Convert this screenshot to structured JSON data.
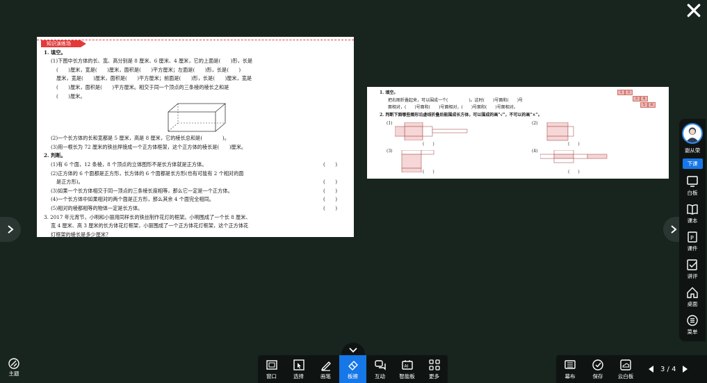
{
  "window": {
    "close_icon": "close-icon"
  },
  "page1": {
    "banner": "知识演练场",
    "q1": {
      "title": "1. 填空。",
      "lines": [
        "(1)下图中长方体的长、宽、高分别是 8 厘米、6 厘米、4 厘米，它的上面是(　　)形，长是",
        "(　　)厘米，宽是(　　)厘米，面积是(　　)平方厘米；左面是(　　)形，长是(　　)",
        "厘米，宽是(　　)厘米，面积是(　　)平方厘米；前面是(　　)形，长是(　　)厘米，宽是",
        "(　　)厘米，面积是(　　)平方厘米。相交于同一个顶点的三条棱的棱长之和是",
        "(　　)厘米。"
      ],
      "line2": "(2)一个长方体的长和宽都是 5 厘米，高是 8 厘米，它的棱长总和是(　　　　)。",
      "line3": "(3)用一根长为 72 厘米的铁丝焊接成一个正方体框架，这个正方体的棱长是(　　)厘米。"
    },
    "q2": {
      "title": "2. 判断。",
      "items": [
        {
          "text": "(1)有 6 个面，12 条棱，8 个顶点的立体图形不是长方体就是正方体。",
          "mark": "(　　)"
        },
        {
          "text": "(2)正方体的 6 个面都是正方形，长方体的 6 个面都是长方形(也有可能有 2 个相对的面",
          "mark": ""
        },
        {
          "text": "是正方形)。",
          "mark": "(　　)"
        },
        {
          "text": "(3)如果一个长方体相交于同一顶点的三条棱长度相等，那么它一定是一个正方体。",
          "mark": "(　　)"
        },
        {
          "text": "(4)一个长方体中如果相对的两个面是正方形，那么其余 4 个面完全相同。",
          "mark": "(　　)"
        },
        {
          "text": "(5)相对的棱都相等的物体一定是长方体。",
          "mark": "(　　)"
        }
      ]
    },
    "q3": {
      "lines": [
        "3. 2017 年元宵节，小明和小丽用同样长的铁丝制作花灯的框架。小明围成了一个长 8 厘米、",
        "宽 4 厘米、高 3 厘米的长方体花灯框架，小丽围成了一个正方体花灯框架，这个正方体花",
        "灯框架的棱长是多少厘米？"
      ]
    }
  },
  "page2": {
    "q1": {
      "title": "1. 填空。",
      "line1": "把右图折叠起来，可以围成一个(　　　　　)。这时(　　)号面和(　　)号",
      "line2": "面相对，(　　)号面和(　　)号面相对，(　　)号面和(　　)号面相对。",
      "cube_numbers": [
        "1",
        "2",
        "3",
        "4",
        "5",
        "6"
      ]
    },
    "q2": {
      "title": "2. 判断下面哪些图形沿虚线折叠后能围成长方体，可以围成的画\"√\"，不可以的画\"×\"。",
      "labels": [
        "(1)",
        "(2)",
        "(3)",
        "(4)"
      ],
      "answer": "(　　)"
    }
  },
  "sidebar": {
    "teacher_name": "谢从荣",
    "end_class": "下课",
    "items": [
      {
        "label": "白板",
        "icon": "whiteboard-icon"
      },
      {
        "label": "课本",
        "icon": "textbook-icon"
      },
      {
        "label": "课件",
        "icon": "courseware-icon"
      },
      {
        "label": "讲评",
        "icon": "review-icon"
      },
      {
        "label": "桌面",
        "icon": "desktop-icon"
      },
      {
        "label": "菜单",
        "icon": "menu-icon"
      }
    ]
  },
  "bottom": {
    "theme": "主题",
    "tools": [
      {
        "label": "窗口",
        "icon": "window-icon"
      },
      {
        "label": "选择",
        "icon": "select-icon"
      },
      {
        "label": "画笔",
        "icon": "pen-icon"
      },
      {
        "label": "板擦",
        "icon": "eraser-icon"
      },
      {
        "label": "互动",
        "icon": "interact-icon"
      },
      {
        "label": "智能板",
        "icon": "ai-board-icon"
      },
      {
        "label": "更多",
        "icon": "more-icon"
      }
    ],
    "right_tools": [
      {
        "label": "幕布",
        "icon": "curtain-icon"
      },
      {
        "label": "保存",
        "icon": "save-icon"
      },
      {
        "label": "云白板",
        "icon": "cloud-whiteboard-icon"
      }
    ],
    "page_indicator": "3 / 4"
  },
  "colors": {
    "background": "#18241e",
    "accent": "#1677e8",
    "banner": "#e33a3a"
  }
}
